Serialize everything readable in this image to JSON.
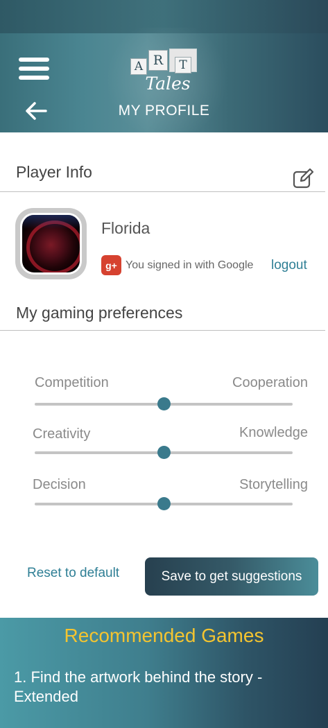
{
  "header": {
    "logo_letters": [
      "A",
      "R",
      "T"
    ],
    "logo_script": "Tales",
    "title": "MY PROFILE"
  },
  "player_info": {
    "title": "Player Info",
    "name": "Florida",
    "signin_text": "You signed in with Google",
    "google_icon_text": "g+",
    "logout_label": "logout"
  },
  "preferences": {
    "title": "My gaming preferences",
    "sliders": [
      {
        "left_label": "Competition",
        "right_label": "Cooperation",
        "value": 0.5
      },
      {
        "left_label": "Creativity",
        "right_label": "Knowledge",
        "value": 0.5
      },
      {
        "left_label": "Decision",
        "right_label": "Storytelling",
        "value": 0.5
      }
    ],
    "reset_label": "Reset to default",
    "save_label": "Save to get suggestions"
  },
  "recommended": {
    "title": "Recommended Games",
    "items": [
      "1. Find the artwork behind the story - Extended"
    ]
  },
  "colors": {
    "accent": "#2f7f95",
    "slider_thumb": "#3a7a8c",
    "recommended_title": "#f4c430",
    "google_red": "#d64230"
  }
}
